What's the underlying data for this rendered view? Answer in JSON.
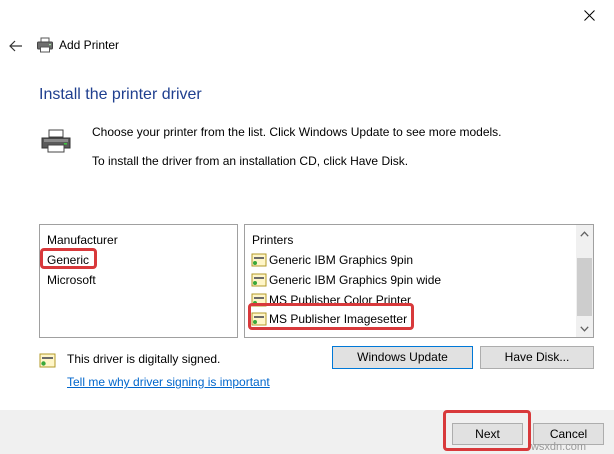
{
  "window": {
    "title": "Add Printer",
    "close_icon": "close-icon",
    "back_icon": "arrow-left-icon"
  },
  "page": {
    "heading": "Install the printer driver",
    "instruction_1": "Choose your printer from the list. Click Windows Update to see more models.",
    "instruction_2": "To install the driver from an installation CD, click Have Disk."
  },
  "manufacturer_list": {
    "header": "Manufacturer",
    "items": [
      "Generic",
      "Microsoft"
    ]
  },
  "printers_list": {
    "header": "Printers",
    "items": [
      "Generic IBM Graphics 9pin",
      "Generic IBM Graphics 9pin wide",
      "MS Publisher Color Printer",
      "MS Publisher Imagesetter"
    ]
  },
  "buttons": {
    "windows_update": "Windows Update",
    "have_disk": "Have Disk...",
    "next": "Next",
    "cancel": "Cancel"
  },
  "signing": {
    "status": "This driver is digitally signed.",
    "link": "Tell me why driver signing is important"
  },
  "watermark": "wsxdn.com",
  "colors": {
    "heading": "#1f3f8f",
    "link": "#0066cc",
    "highlight": "#d8393b",
    "accent_border": "#0078d7"
  }
}
